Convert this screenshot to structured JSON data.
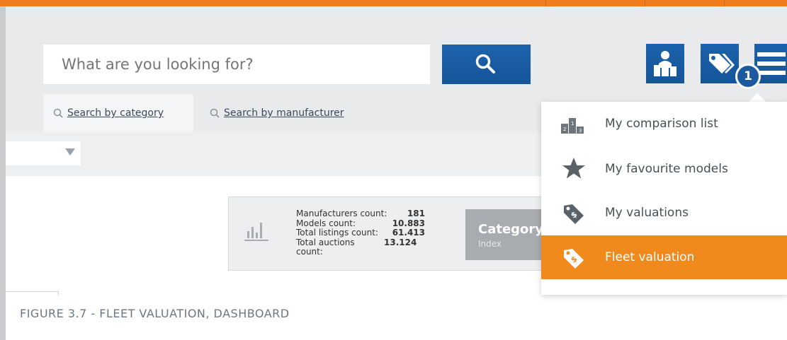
{
  "search": {
    "placeholder": "What are you looking for?",
    "button_icon": "search-icon"
  },
  "header_icons": [
    "user-podium-icon",
    "price-tags-icon",
    "hamburger-menu-icon"
  ],
  "badge": "1",
  "tabs": [
    {
      "label": "Search by category",
      "active": true
    },
    {
      "label": "Search by manufacturer",
      "active": false
    }
  ],
  "stats": {
    "rows": [
      {
        "label": "Manufacturers count:",
        "value": "181"
      },
      {
        "label": "Models count:",
        "value": "10.883"
      },
      {
        "label": "Total listings count:",
        "value": "61.413"
      },
      {
        "label": "Total auctions count:",
        "value": "13.124"
      }
    ],
    "category_title": "Category",
    "category_sub": "Index"
  },
  "menu": {
    "items": [
      {
        "label": "My comparison list",
        "icon": "podium-icon",
        "active": false
      },
      {
        "label": "My favourite models",
        "icon": "star-icon",
        "active": false
      },
      {
        "label": "My valuations",
        "icon": "price-tag-icon",
        "active": false
      },
      {
        "label": "Fleet valuation",
        "icon": "price-tag-icon",
        "active": true
      }
    ]
  },
  "caption": "FIGURE 3.7 - FLEET VALUATION, DASHBOARD",
  "colors": {
    "accent_orange": "#ef7d1e",
    "menu_active": "#f08a1d",
    "primary_blue": "#1b5fa9",
    "header_bg": "#e8eaec"
  }
}
